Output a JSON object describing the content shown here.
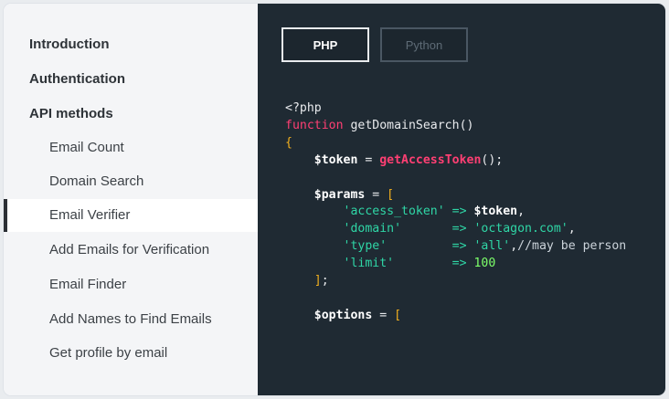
{
  "sidebar": {
    "items": [
      {
        "label": "Introduction",
        "level": "top",
        "active": false
      },
      {
        "label": "Authentication",
        "level": "top",
        "active": false
      },
      {
        "label": "API methods",
        "level": "top",
        "active": false
      },
      {
        "label": "Email Count",
        "level": "sub",
        "active": false
      },
      {
        "label": "Domain Search",
        "level": "sub",
        "active": false
      },
      {
        "label": "Email Verifier",
        "level": "sub",
        "active": true
      },
      {
        "label": "Add Emails for Verification",
        "level": "sub",
        "active": false
      },
      {
        "label": "Email Finder",
        "level": "sub",
        "active": false
      },
      {
        "label": "Add Names to Find Emails",
        "level": "sub",
        "active": false
      },
      {
        "label": "Get profile by email",
        "level": "sub",
        "active": false
      }
    ]
  },
  "code_panel": {
    "tabs": [
      {
        "label": "PHP",
        "selected": true
      },
      {
        "label": "Python",
        "selected": false
      }
    ],
    "language": "PHP",
    "code_lines": [
      "<?php",
      "function getDomainSearch()",
      "{",
      "    $token = getAccessToken();",
      "",
      "    $params = [",
      "        'access_token' => $token,",
      "        'domain'       => 'octagon.com',",
      "        'type'         => 'all',//may be person",
      "        'limit'        => 100",
      "    ];",
      "",
      "    $options = ["
    ]
  },
  "colors": {
    "code_background": "#1f2a33",
    "sidebar_background": "#f4f5f7",
    "keyword": "#ff3f73",
    "string": "#2fd6a6",
    "number": "#7dff6a",
    "brace": "#f2b01e"
  }
}
